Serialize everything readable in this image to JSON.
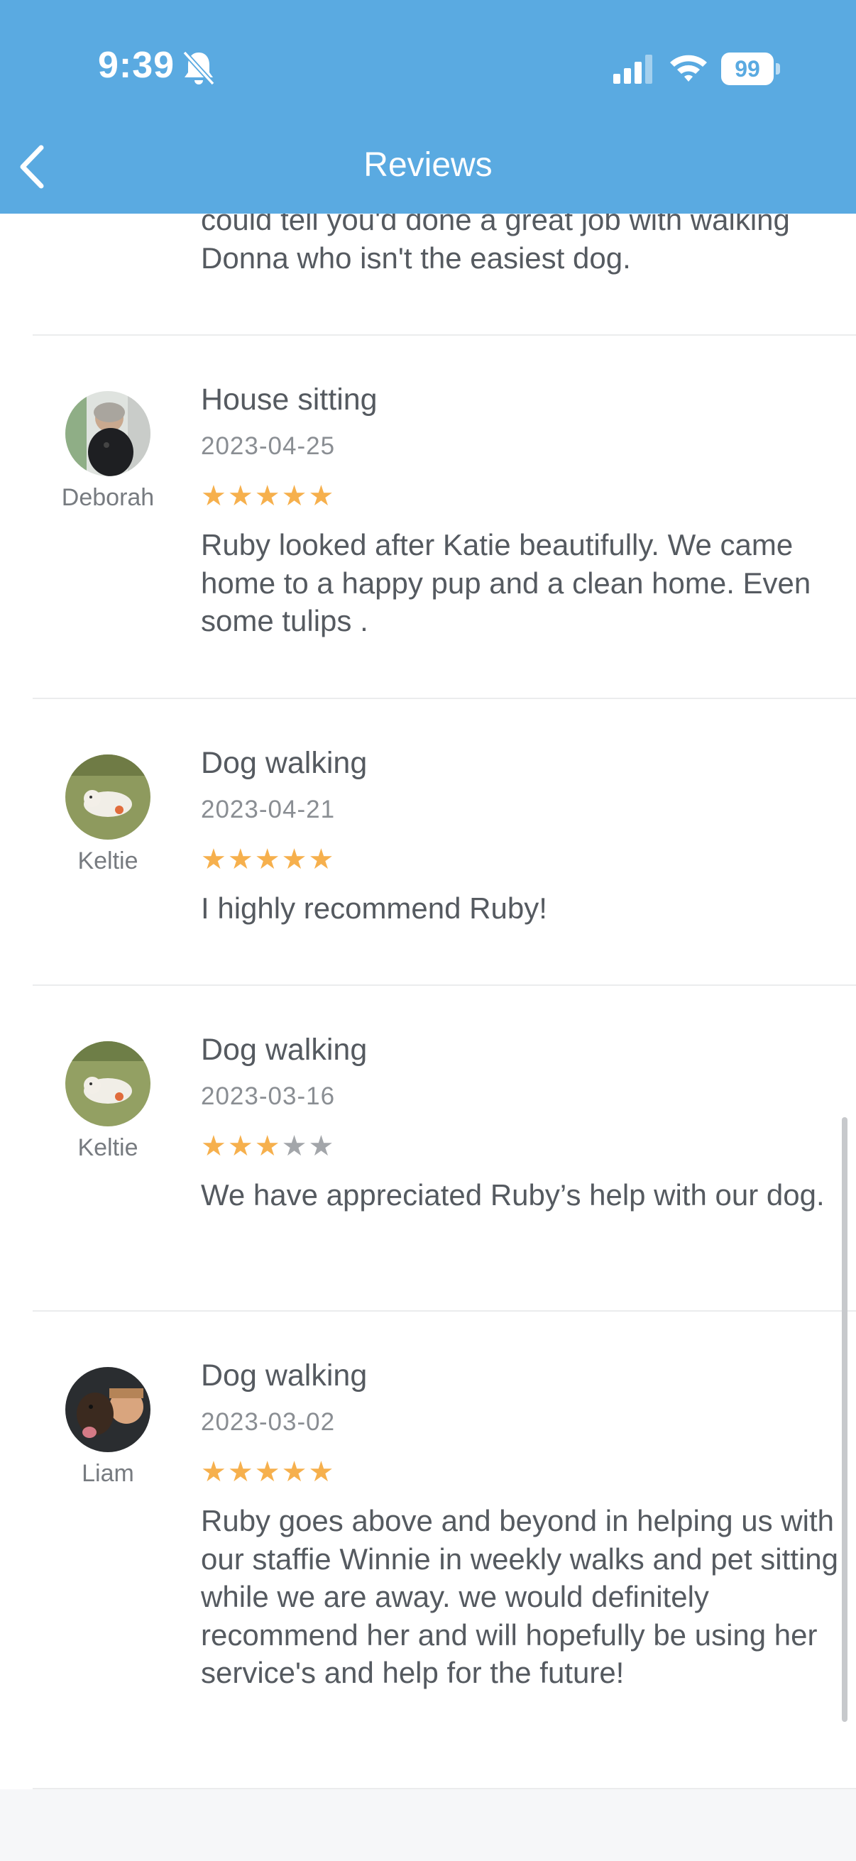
{
  "status_bar": {
    "time": "9:39",
    "battery": "99"
  },
  "header": {
    "title": "Reviews"
  },
  "partial_review": {
    "text": "could tell you'd done a great job with walking Donna who isn't the easiest dog."
  },
  "reviews": [
    {
      "reviewer": "Deborah",
      "service": "House sitting",
      "date": "2023-04-25",
      "rating": 5,
      "text": "Ruby looked after Katie beautifully. We came home to a happy pup and a clean home. Even some tulips ."
    },
    {
      "reviewer": "Keltie",
      "service": "Dog walking",
      "date": "2023-04-21",
      "rating": 5,
      "text": "I highly recommend Ruby!"
    },
    {
      "reviewer": "Keltie",
      "service": "Dog walking",
      "date": "2023-03-16",
      "rating": 3,
      "text": "We have appreciated Ruby’s help with our dog."
    },
    {
      "reviewer": "Liam",
      "service": "Dog walking",
      "date": "2023-03-02",
      "rating": 5,
      "text": "Ruby goes above and beyond in helping us with our staffie Winnie in weekly walks and pet sitting while we are away. we would definitely recommend her and will hopefully be using her service's and help for the future!"
    }
  ],
  "colors": {
    "header": "#5aaae1",
    "star_filled": "#f6b04d",
    "star_empty": "#a3a6aa"
  },
  "icons": [
    "bell-slash-icon",
    "signal-icon",
    "wifi-icon",
    "battery-icon",
    "back-chevron-icon",
    "star-icon"
  ]
}
